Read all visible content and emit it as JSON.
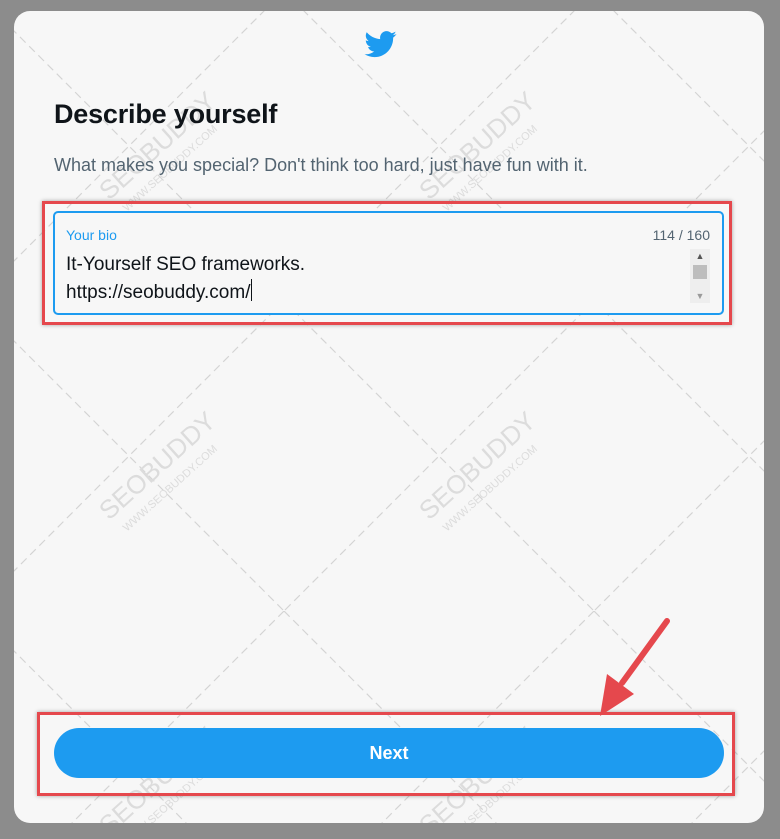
{
  "header": {
    "logo": "twitter-bird-icon",
    "title": "Describe yourself",
    "subtitle": "What makes you special? Don't think too hard, just have fun with it."
  },
  "bio_field": {
    "label": "Your bio",
    "counter": "114 / 160",
    "value": "It-Yourself SEO frameworks.\nhttps://seobuddy.com/"
  },
  "footer": {
    "next_label": "Next"
  },
  "colors": {
    "brand_blue": "#1d9bf0",
    "annotation_red": "#e5484d",
    "modal_background": "#f7f7f7"
  },
  "watermark": {
    "text": "SEOBUDDY",
    "url": "WWW.SEOBUDDY.COM"
  }
}
